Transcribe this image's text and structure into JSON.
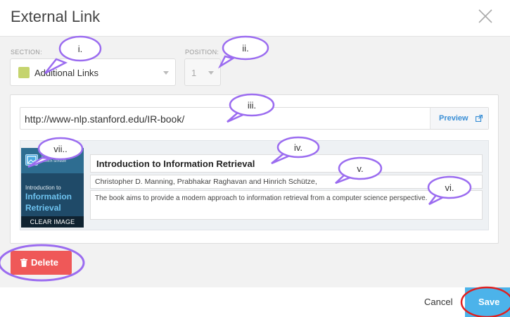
{
  "header": {
    "title": "External Link",
    "close_icon": "close-icon"
  },
  "section": {
    "label": "SECTION:",
    "value": "Additional Links",
    "swatch_color": "#c5d46e"
  },
  "position": {
    "label": "POSITION:",
    "value": "1"
  },
  "url": {
    "value": "http://www-nlp.stanford.edu/IR-book/",
    "preview_label": "Preview",
    "preview_icon": "external-link-icon"
  },
  "card": {
    "title": "Introduction to Information Retrieval",
    "authors": "Christopher D. Manning, Prabhakar Raghavan and Hinrich Schütze,",
    "description": "The book aims to provide a modern approach to information retrieval from a computer science perspective.",
    "thumbnail": {
      "authors": [
        "Christopher D. Manning",
        "Prabhakar Raghavan",
        "Hinrich Schütze"
      ],
      "line1": "Introduction to",
      "line2": "Information",
      "line3": "Retrieval",
      "clear_label": "CLEAR IMAGE",
      "edit_icon": "image-edit-icon"
    }
  },
  "actions": {
    "delete_label": "Delete",
    "cancel_label": "Cancel",
    "save_label": "Save"
  },
  "annotations": [
    "i.",
    "ii.",
    "iii.",
    "iv.",
    "v.",
    "vi.",
    "vii.."
  ],
  "colors": {
    "accent_purple": "#9b6cf0",
    "save_blue": "#4cb3ea",
    "delete_red": "#ef5858",
    "save_ring_red": "#e02020"
  }
}
